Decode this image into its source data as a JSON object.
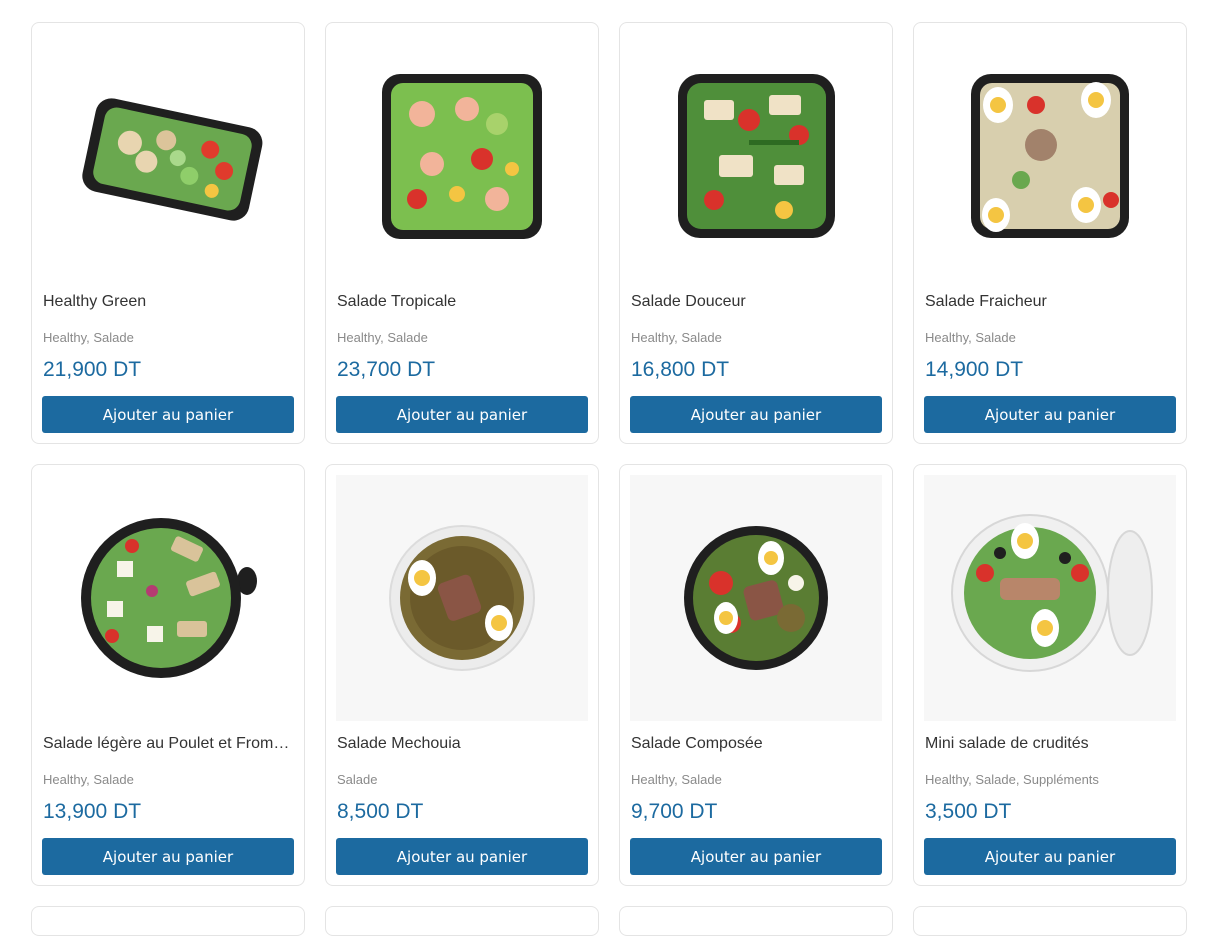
{
  "products": [
    {
      "name": "Healthy Green",
      "categories": "Healthy, Salade",
      "price": "21,900 DT",
      "button_label": "Ajouter au panier",
      "image_icon": "salad-tray-icon"
    },
    {
      "name": "Salade Tropicale",
      "categories": "Healthy, Salade",
      "price": "23,700 DT",
      "button_label": "Ajouter au panier",
      "image_icon": "salad-tray-icon"
    },
    {
      "name": "Salade Douceur",
      "categories": "Healthy, Salade",
      "price": "16,800 DT",
      "button_label": "Ajouter au panier",
      "image_icon": "salad-tray-icon"
    },
    {
      "name": "Salade Fraicheur",
      "categories": "Healthy, Salade",
      "price": "14,900 DT",
      "button_label": "Ajouter au panier",
      "image_icon": "salad-tray-icon"
    },
    {
      "name": "Salade légère au Poulet et Fromage",
      "categories": "Healthy, Salade",
      "price": "13,900 DT",
      "button_label": "Ajouter au panier",
      "image_icon": "salad-bowl-icon"
    },
    {
      "name": "Salade Mechouia",
      "categories": "Salade",
      "price": "8,500 DT",
      "button_label": "Ajouter au panier",
      "image_icon": "salad-bowl-icon"
    },
    {
      "name": "Salade Composée",
      "categories": "Healthy, Salade",
      "price": "9,700 DT",
      "button_label": "Ajouter au panier",
      "image_icon": "salad-bowl-icon"
    },
    {
      "name": "Mini salade de crudités",
      "categories": "Healthy, Salade, Suppléments",
      "price": "3,500 DT",
      "button_label": "Ajouter au panier",
      "image_icon": "salad-bowl-icon"
    }
  ],
  "colors": {
    "accent": "#1c6aa0",
    "muted_text": "#8a8a8a",
    "card_border": "#e4e4e4"
  }
}
